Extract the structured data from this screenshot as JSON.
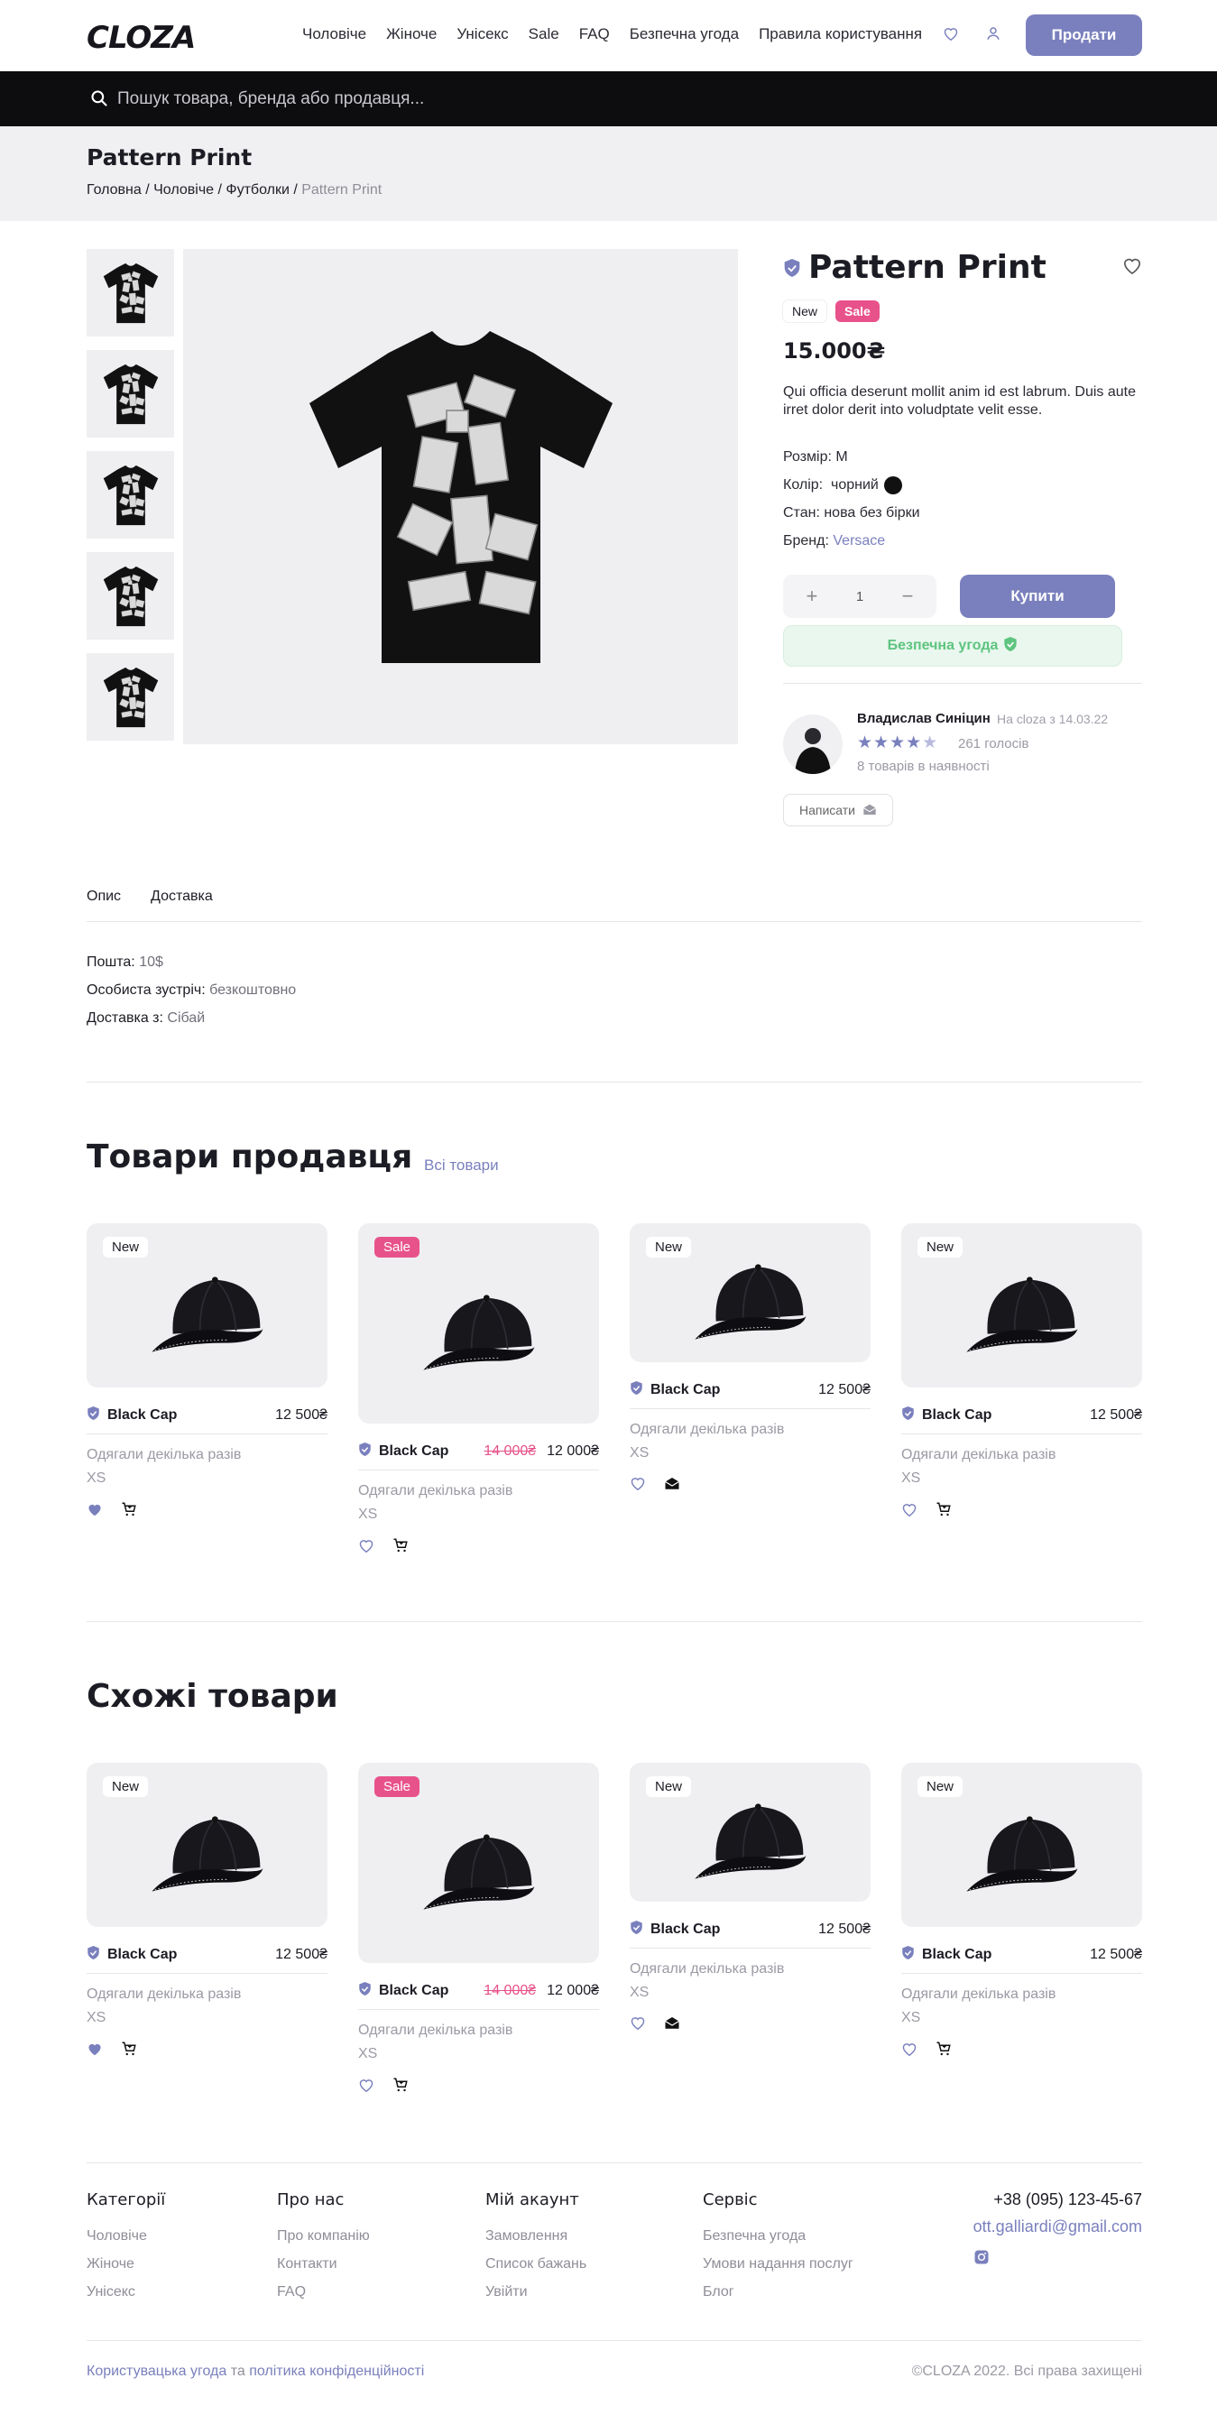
{
  "header": {
    "logo": "CLOZA",
    "nav": [
      "Чоловіче",
      "Жіноче",
      "Унісекс",
      "Sale",
      "FAQ",
      "Безпечна угода",
      "Правила користування"
    ],
    "sell_label": "Продати"
  },
  "search": {
    "placeholder": "Пошук товара, бренда або продавця..."
  },
  "page": {
    "title": "Pattern Print",
    "breadcrumb": [
      "Головна",
      "Чоловіче",
      "Футболки"
    ],
    "breadcrumb_current": "Pattern Print"
  },
  "product": {
    "title": "Pattern Print",
    "badge_new": "New",
    "badge_sale": "Sale",
    "price": "15.000₴",
    "description": "Qui officia deserunt mollit anim id est labrum. Duis aute irret dolor derit into voludptate velit esse.",
    "size_label": "Розмір:",
    "size_value": "M",
    "color_label": "Колір:",
    "color_value": "чорний",
    "condition_label": "Стан:",
    "condition_value": "нова без бірки",
    "brand_label": "Бренд:",
    "brand_value": "Versace",
    "qty": "1",
    "qty_minus": "−",
    "qty_plus": "+",
    "buy_label": "Купити",
    "safe_deal": "Безпечна угода"
  },
  "seller": {
    "name": "Владислав Синіцин",
    "since": "На cloza з 14.03.22",
    "rating": 4.5,
    "votes": "261 голосів",
    "stock": "8 товарів в наявності",
    "write_label": "Написати"
  },
  "tabs": [
    "Опис",
    "Доставка"
  ],
  "shipping": [
    {
      "label": "Пошта:",
      "value": "10$"
    },
    {
      "label": "Особиста зустріч:",
      "value": "безкоштовно"
    },
    {
      "label": "Доставка з:",
      "value": "Сібай"
    }
  ],
  "seller_products": {
    "title": "Товари продавця",
    "all_link": "Всі товари",
    "items": [
      {
        "tag": "New",
        "name": "Black Cap",
        "old_price": "",
        "price": "12 500₴",
        "condition": "Одягали декілька разів",
        "size": "XS",
        "second_icon": "cart"
      },
      {
        "tag": "Sale",
        "name": "Black Cap",
        "old_price": "14 000₴",
        "price": "12 000₴",
        "condition": "Одягали декілька разів",
        "size": "XS",
        "second_icon": "cart"
      },
      {
        "tag": "New",
        "name": "Black Cap",
        "old_price": "",
        "price": "12 500₴",
        "condition": "Одягали декілька разів",
        "size": "XS",
        "second_icon": "mail"
      },
      {
        "tag": "New",
        "name": "Black Cap",
        "old_price": "",
        "price": "12 500₴",
        "condition": "Одягали декілька разів",
        "size": "XS",
        "second_icon": "cart"
      }
    ]
  },
  "similar_products": {
    "title": "Схожі товари",
    "items": [
      {
        "tag": "New",
        "name": "Black Cap",
        "old_price": "",
        "price": "12 500₴",
        "condition": "Одягали декілька разів",
        "size": "XS",
        "second_icon": "cart"
      },
      {
        "tag": "Sale",
        "name": "Black Cap",
        "old_price": "14 000₴",
        "price": "12 000₴",
        "condition": "Одягали декілька разів",
        "size": "XS",
        "second_icon": "cart"
      },
      {
        "tag": "New",
        "name": "Black Cap",
        "old_price": "",
        "price": "12 500₴",
        "condition": "Одягали декілька разів",
        "size": "XS",
        "second_icon": "mail"
      },
      {
        "tag": "New",
        "name": "Black Cap",
        "old_price": "",
        "price": "12 500₴",
        "condition": "Одягали декілька разів",
        "size": "XS",
        "second_icon": "cart"
      }
    ]
  },
  "footer": {
    "columns": [
      {
        "title": "Категорії",
        "links": [
          "Чоловіче",
          "Жіноче",
          "Унісекс"
        ]
      },
      {
        "title": "Про нас",
        "links": [
          "Про компанію",
          "Контакти",
          "FAQ"
        ]
      },
      {
        "title": "Мій акаунт",
        "links": [
          "Замовлення",
          "Список бажань",
          "Увійти"
        ]
      },
      {
        "title": "Сервіс",
        "links": [
          "Безпечна угода",
          "Умови надання послуг",
          "Блог"
        ]
      }
    ],
    "phone": "+38 (095) 123-45-67",
    "email": "ott.galliardi@gmail.com",
    "social_icon": "instagram-icon",
    "agreement": "Користувацька угода",
    "and": "та",
    "privacy": "політика конфіденційності",
    "copyright": "©CLOZA 2022. Всі права захищені"
  },
  "colors": {
    "accent": "#7a80bd",
    "sale": "#e8528a",
    "safe_green": "#5ec47f",
    "search_bg": "#0d0d0f"
  }
}
